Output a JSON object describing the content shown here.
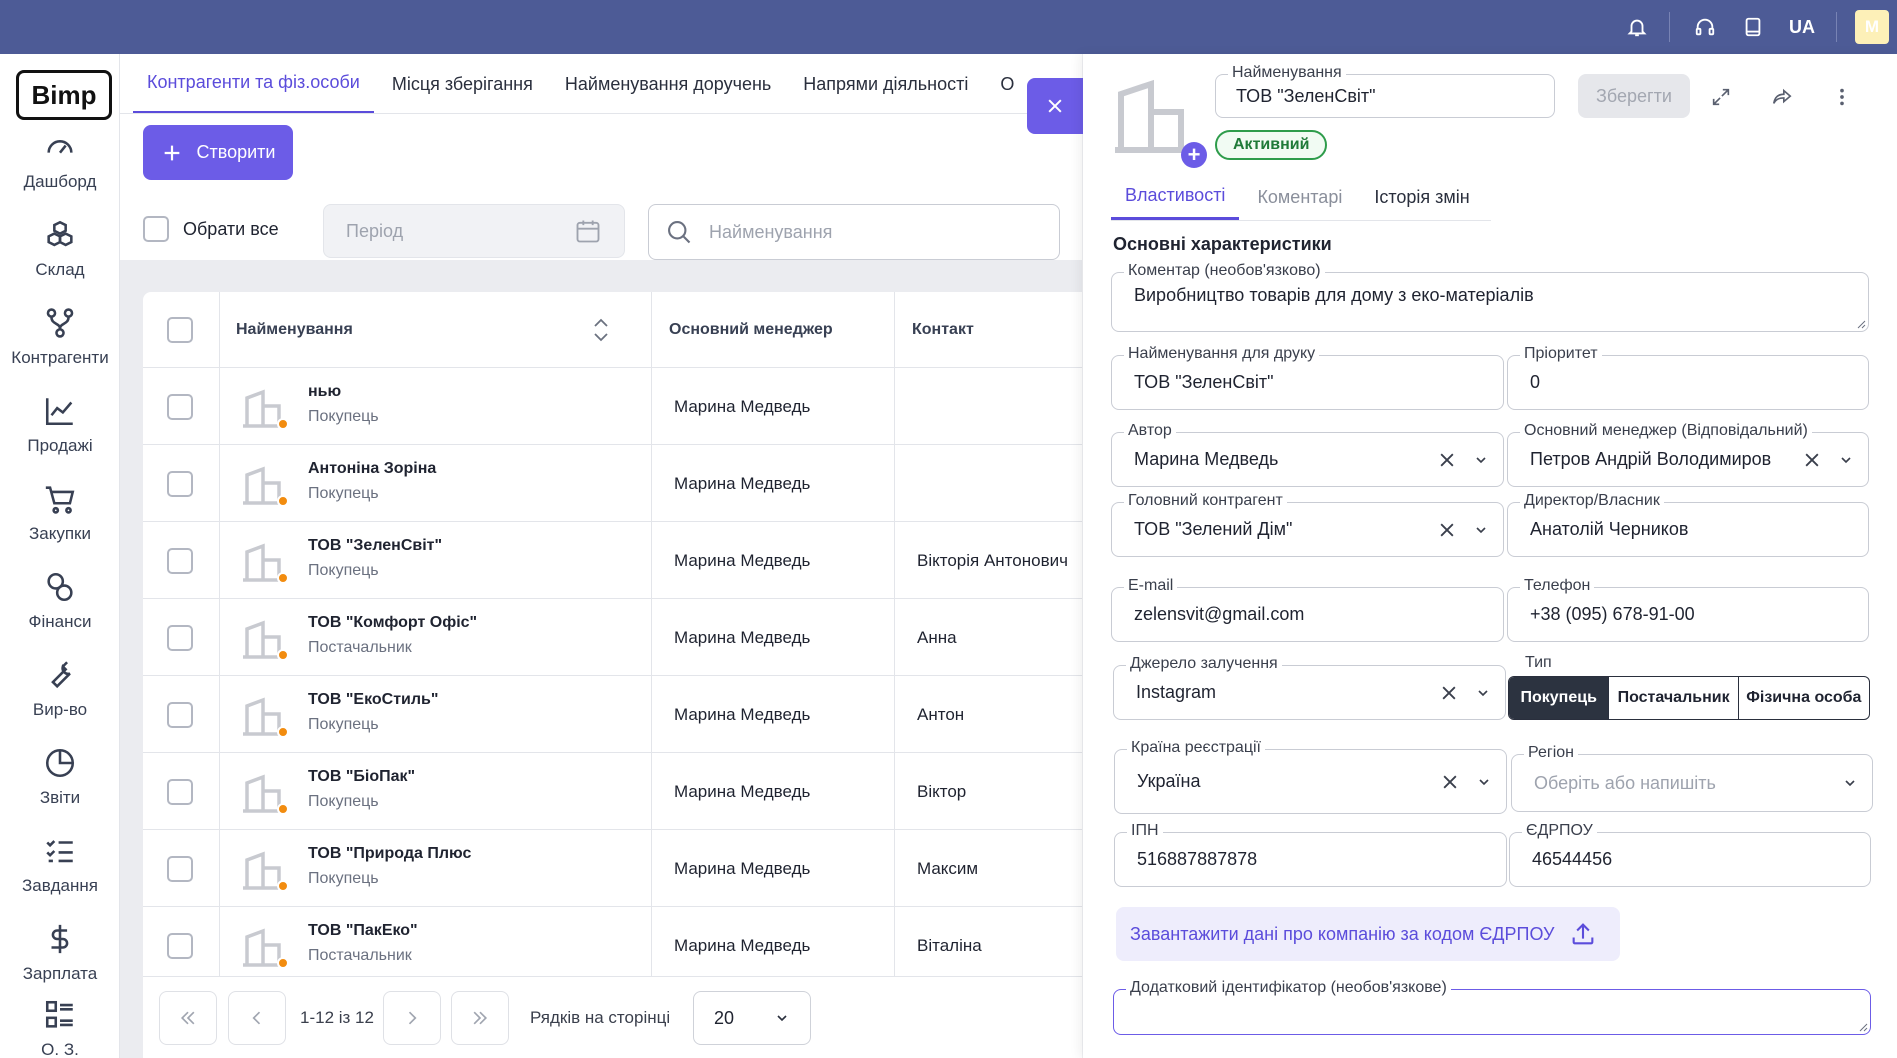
{
  "topbar": {
    "icons": [
      "bell-icon",
      "headset-icon",
      "book-icon"
    ],
    "language": "UA",
    "avatar_initial": "M"
  },
  "sidebar": {
    "logo": "Bimp",
    "items": [
      {
        "label": "Дашборд",
        "icon": "speedometer-icon"
      },
      {
        "label": "Склад",
        "icon": "boxes-icon"
      },
      {
        "label": "Контрагенти",
        "icon": "network-icon"
      },
      {
        "label": "Продажі",
        "icon": "chart-icon"
      },
      {
        "label": "Закупки",
        "icon": "cart-icon"
      },
      {
        "label": "Фінанси",
        "icon": "coins-icon"
      },
      {
        "label": "Вир-во",
        "icon": "wrench-icon"
      },
      {
        "label": "Звіти",
        "icon": "pie-icon"
      },
      {
        "label": "Завдання",
        "icon": "checklist-icon"
      },
      {
        "label": "Зарплата",
        "icon": "dollar-icon"
      },
      {
        "label": "О. З.",
        "icon": "list-icon"
      }
    ]
  },
  "main": {
    "tabs": [
      "Контрагенти та фіз.особи",
      "Місця зберігання",
      "Найменування доручень",
      "Напрями діяльності",
      "О"
    ],
    "create_label": "Створити",
    "select_all_label": "Обрати все",
    "period_placeholder": "Період",
    "search_placeholder": "Найменування",
    "table": {
      "columns": [
        "Найменування",
        "Основний менеджер",
        "Контакт"
      ],
      "rows": [
        {
          "name": "нью",
          "type": "Покупець",
          "manager": "Марина Медведь",
          "contact": ""
        },
        {
          "name": "Антоніна Зоріна",
          "type": "Покупець",
          "manager": "Марина Медведь",
          "contact": ""
        },
        {
          "name": "ТОВ \"ЗеленСвіт\"",
          "type": "Покупець",
          "manager": "Марина Медведь",
          "contact": "Вікторія Антонович"
        },
        {
          "name": "ТОВ \"Комфорт Офіс\"",
          "type": "Постачальник",
          "manager": "Марина Медведь",
          "contact": "Анна"
        },
        {
          "name": "ТОВ \"ЕкоСтиль\"",
          "type": "Покупець",
          "manager": "Марина Медведь",
          "contact": "Антон"
        },
        {
          "name": "ТОВ \"БіоПак\"",
          "type": "Покупець",
          "manager": "Марина Медведь",
          "contact": "Віктор"
        },
        {
          "name": "ТОВ \"Природа Плюс",
          "type": "Покупець",
          "manager": "Марина Медведь",
          "contact": "Максим"
        },
        {
          "name": "ТОВ \"ПакЕко\"",
          "type": "Постачальник",
          "manager": "Марина Медведь",
          "contact": "Віталіна"
        }
      ]
    },
    "pager": {
      "range": "1-12 із 12",
      "rows_label": "Рядків на сторінці",
      "rows_value": "20"
    }
  },
  "panel": {
    "name_label": "Найменування",
    "name_value": "ТОВ \"ЗеленСвіт\"",
    "save_label": "Зберегти",
    "status": "Активний",
    "tabs": [
      "Властивості",
      "Коментарі",
      "Історія змін"
    ],
    "section_title": "Основні характеристики",
    "fields": {
      "comment": {
        "label": "Коментар (необов'язково)",
        "value": "Виробництво товарів для дому з еко-матеріалів"
      },
      "print_name": {
        "label": "Найменування для друку",
        "value": "ТОВ \"ЗеленСвіт\""
      },
      "priority": {
        "label": "Пріоритет",
        "value": "0"
      },
      "author": {
        "label": "Автор",
        "value": "Марина Медведь"
      },
      "main_manager": {
        "label": "Основний менеджер (Відповідальний)",
        "value": "Петров Андрій Володимиров"
      },
      "parent": {
        "label": "Головний контрагент",
        "value": "ТОВ \"Зелений Дім\""
      },
      "director": {
        "label": "Директор/Власник",
        "value": "Анатолій Черников"
      },
      "email": {
        "label": "E-mail",
        "value": "zelensvit@gmail.com"
      },
      "phone": {
        "label": "Телефон",
        "value": "+38 (095) 678-91-00"
      },
      "source": {
        "label": "Джерело залучення",
        "value": "Instagram"
      },
      "type": {
        "label": "Тип",
        "options": [
          "Покупець",
          "Постачальник",
          "Фізична особа"
        ],
        "selected": "Покупець"
      },
      "country": {
        "label": "Країна реєстрації",
        "value": "Україна"
      },
      "region": {
        "label": "Регіон",
        "placeholder": "Оберіть або напишіть"
      },
      "ipn": {
        "label": "ІПН",
        "value": "516887887878"
      },
      "edrpou": {
        "label": "ЄДРПОУ",
        "value": "46544456"
      },
      "extra_id": {
        "label": "Додатковий ідентифікатор (необов'язкове)",
        "value": ""
      }
    },
    "edrpou_button": "Завантажити дані про компанію за кодом ЄДРПОУ"
  },
  "colors": {
    "accent": "#6c5ce7",
    "topbar": "#4d5b96",
    "status_green": "#2e9c4b",
    "dot_orange": "#f28c0f"
  }
}
